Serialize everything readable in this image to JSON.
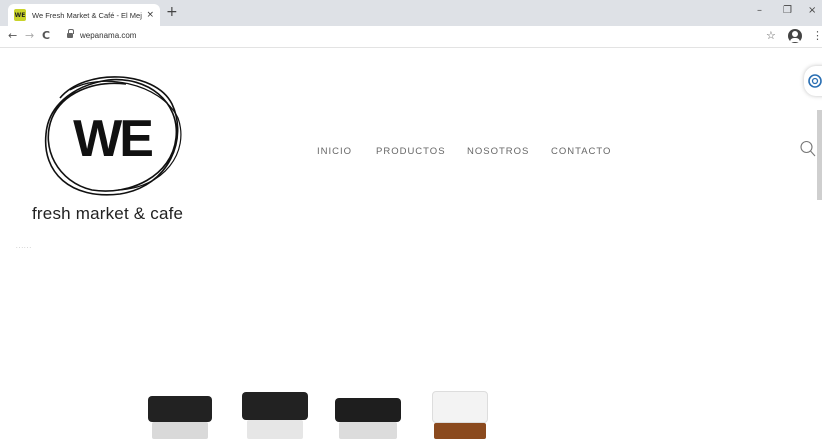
{
  "browser": {
    "tab_title": "We Fresh Market & Café - El Mej",
    "favicon_text": "WE",
    "url": "wepanama.com",
    "new_tab": "+",
    "tab_close": "×",
    "back": "←",
    "forward": "→",
    "reload": "C",
    "minimize": "–",
    "restore": "❐",
    "close": "×",
    "star": "☆",
    "menu": "⋮"
  },
  "site": {
    "logo_text": "WE",
    "tagline": "fresh market & cafe",
    "nav": [
      "INICIO",
      "PRODUCTOS",
      "NOSOTROS",
      "CONTACTO"
    ],
    "dots": "......",
    "colors": {
      "logo": "#111111",
      "nav_text": "#666666",
      "favicon": "#c9d32a"
    }
  }
}
